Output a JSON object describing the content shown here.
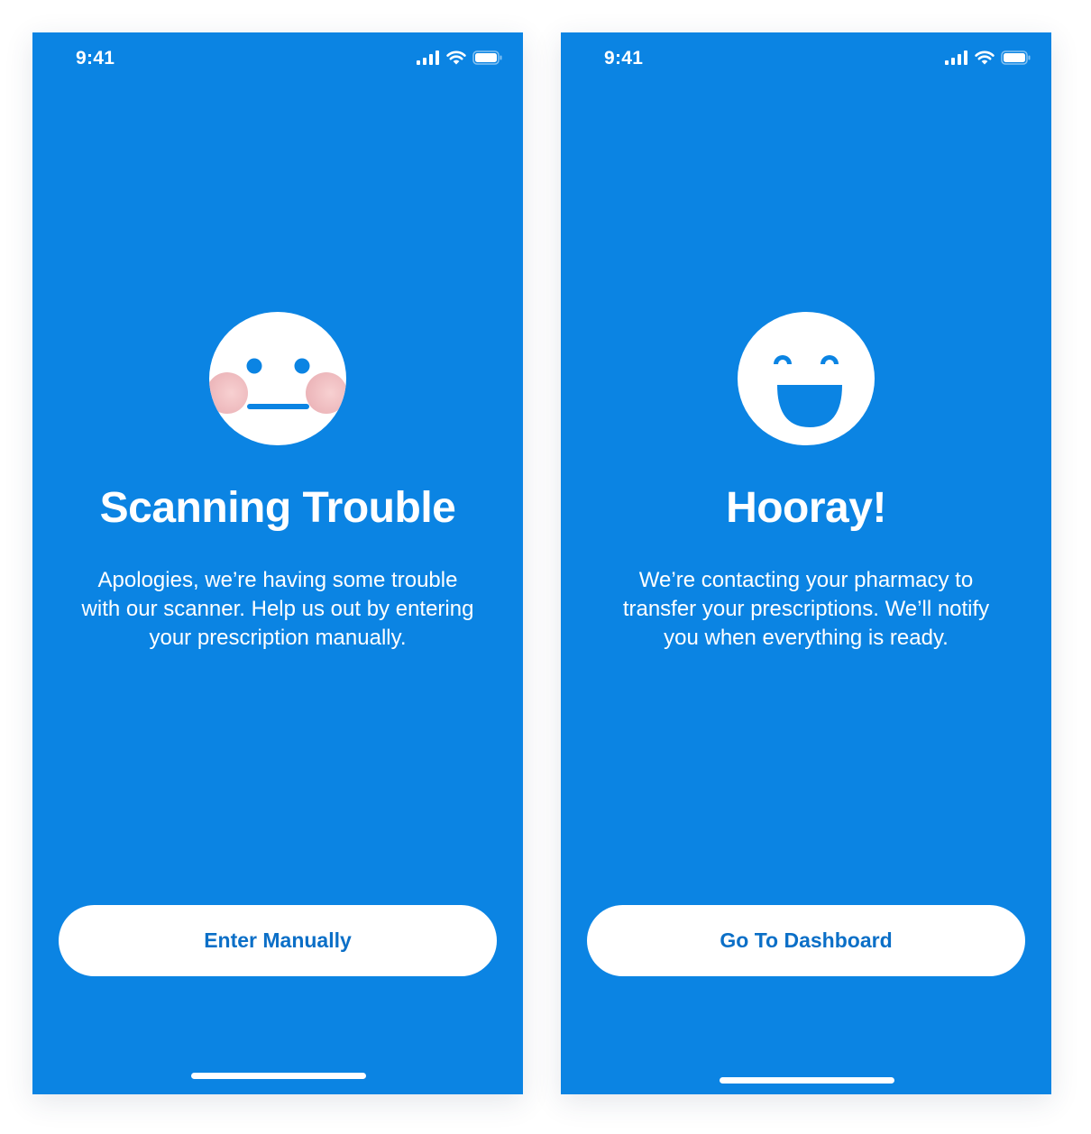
{
  "screens": [
    {
      "status_time": "9:41",
      "title": "Scanning Trouble",
      "message_lines": [
        "Apologies, we’re having some trouble",
        "with our scanner. Help us out by entering",
        "your prescription manually."
      ],
      "button_label": "Enter Manually",
      "face_icon": "neutral-blushing-face-icon"
    },
    {
      "status_time": "9:41",
      "title": "Hooray!",
      "message_lines": [
        "We’re contacting your pharmacy to",
        "transfer your prescriptions. We’ll notify",
        "you when everything is ready."
      ],
      "button_label": "Go To Dashboard",
      "face_icon": "laughing-face-icon"
    }
  ],
  "colors": {
    "background": "#0B84E3",
    "button_text": "#0B6FC7",
    "white": "#FFFFFF",
    "blush": "#F0B4B8"
  }
}
